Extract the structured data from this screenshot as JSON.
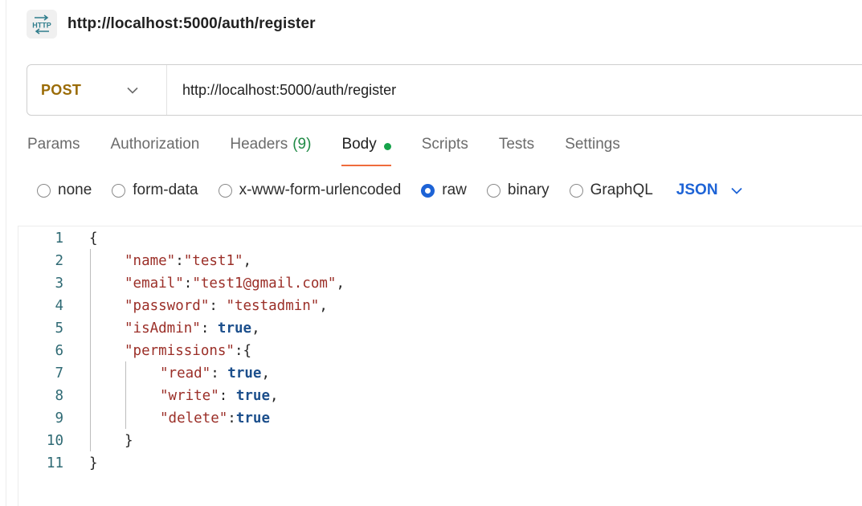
{
  "request": {
    "title": "http://localhost:5000/auth/register",
    "method": "POST",
    "url": "http://localhost:5000/auth/register"
  },
  "colors": {
    "method": "#9a6b06",
    "active_tab_underline": "#ef6c3c",
    "tab_count": "#1f8a45",
    "body_dot": "#16a34a",
    "accent_blue": "#1d63d6"
  },
  "icons": {
    "header": "http-icon",
    "method_dropdown": "chevron-down-icon",
    "format_dropdown": "chevron-down-icon"
  },
  "tabs": [
    {
      "label": "Params",
      "active": false
    },
    {
      "label": "Authorization",
      "active": false
    },
    {
      "label": "Headers",
      "count": "(9)",
      "active": false
    },
    {
      "label": "Body",
      "active": true,
      "dot": true
    },
    {
      "label": "Scripts",
      "active": false
    },
    {
      "label": "Tests",
      "active": false
    },
    {
      "label": "Settings",
      "active": false
    }
  ],
  "body_options": {
    "types": [
      {
        "label": "none",
        "selected": false
      },
      {
        "label": "form-data",
        "selected": false
      },
      {
        "label": "x-www-form-urlencoded",
        "selected": false
      },
      {
        "label": "raw",
        "selected": true
      },
      {
        "label": "binary",
        "selected": false
      },
      {
        "label": "GraphQL",
        "selected": false
      }
    ],
    "format": "JSON"
  },
  "editor": {
    "lines": [
      {
        "num": "1",
        "tokens": [
          [
            "punct",
            "{"
          ]
        ]
      },
      {
        "num": "2",
        "tokens": [
          [
            "key",
            "\"name\""
          ],
          [
            "punct",
            ":"
          ],
          [
            "str",
            "\"test1\""
          ],
          [
            "punct",
            ","
          ]
        ]
      },
      {
        "num": "3",
        "tokens": [
          [
            "key",
            "\"email\""
          ],
          [
            "punct",
            ":"
          ],
          [
            "str",
            "\"test1@gmail.com\""
          ],
          [
            "punct",
            ","
          ]
        ]
      },
      {
        "num": "4",
        "tokens": [
          [
            "key",
            "\"password\""
          ],
          [
            "punct",
            ": "
          ],
          [
            "str",
            "\"testadmin\""
          ],
          [
            "punct",
            ","
          ]
        ]
      },
      {
        "num": "5",
        "tokens": [
          [
            "key",
            "\"isAdmin\""
          ],
          [
            "punct",
            ": "
          ],
          [
            "bool",
            "true"
          ],
          [
            "punct",
            ","
          ]
        ]
      },
      {
        "num": "6",
        "tokens": [
          [
            "key",
            "\"permissions\""
          ],
          [
            "punct",
            ":{"
          ]
        ]
      },
      {
        "num": "7",
        "tokens": [
          [
            "key",
            "\"read\""
          ],
          [
            "punct",
            ": "
          ],
          [
            "bool",
            "true"
          ],
          [
            "punct",
            ","
          ]
        ]
      },
      {
        "num": "8",
        "tokens": [
          [
            "key",
            "\"write\""
          ],
          [
            "punct",
            ": "
          ],
          [
            "bool",
            "true"
          ],
          [
            "punct",
            ","
          ]
        ]
      },
      {
        "num": "9",
        "tokens": [
          [
            "key",
            "\"delete\""
          ],
          [
            "punct",
            ":"
          ],
          [
            "bool",
            "true"
          ]
        ]
      },
      {
        "num": "10",
        "tokens": [
          [
            "punct",
            "}"
          ]
        ]
      },
      {
        "num": "11",
        "tokens": [
          [
            "punct",
            "}"
          ]
        ]
      }
    ]
  }
}
